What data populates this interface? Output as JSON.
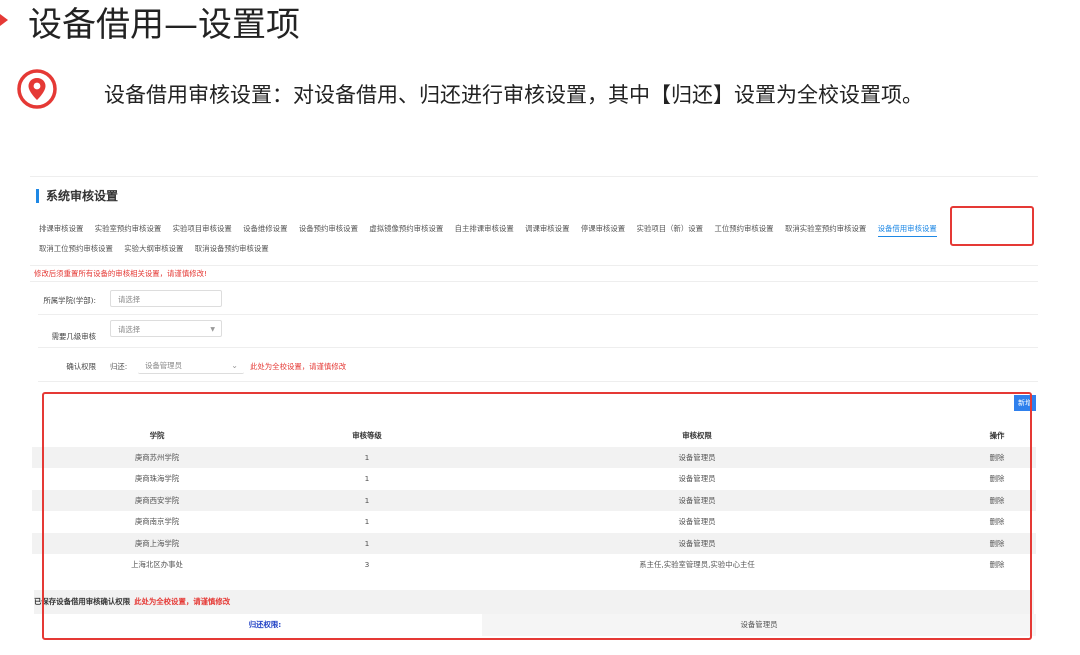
{
  "slide": {
    "title": "设备借用—设置项",
    "description": "设备借用审核设置：对设备借用、归还进行审核设置，其中【归还】设置为全校设置项。"
  },
  "panel": {
    "title": "系统审核设置",
    "tabs": [
      "排课审核设置",
      "实验室预约审核设置",
      "实验项目审核设置",
      "设备维修设置",
      "设备预约审核设置",
      "虚拟镜像预约审核设置",
      "自主排课审核设置",
      "调课审核设置",
      "停课审核设置",
      "实验项目（新）设置",
      "工位预约审核设置",
      "取消实验室预约审核设置",
      "设备借用审核设置",
      "取消工位预约审核设置",
      "实验大纲审核设置",
      "取消设备预约审核设置"
    ],
    "active_tab": "设备借用审核设置",
    "warning": "修改后须重置所有设备的审核相关设置，请谨慎修改!",
    "form": {
      "college_label": "所属学院(学部):",
      "college_placeholder": "请选择",
      "levels_label": "需要几级审核",
      "levels_placeholder": "请选择",
      "confirm_label": "确认权限",
      "return_prefix": "归还:",
      "return_value": "设备管理员",
      "return_note_a": "此处为全校设置，",
      "return_note_b": "请谨慎修改"
    },
    "new_button": "新增",
    "table": {
      "headers": [
        "学院",
        "审核等级",
        "审核权限",
        "操作"
      ],
      "rows": [
        [
          "庚商苏州学院",
          "1",
          "设备管理员",
          "删除"
        ],
        [
          "庚商珠海学院",
          "1",
          "设备管理员",
          "删除"
        ],
        [
          "庚商西安学院",
          "1",
          "设备管理员",
          "删除"
        ],
        [
          "庚商南京学院",
          "1",
          "设备管理员",
          "删除"
        ],
        [
          "庚商上海学院",
          "1",
          "设备管理员",
          "删除"
        ],
        [
          "上海北区办事处",
          "3",
          "系主任,实验室管理员,实验中心主任",
          "删除"
        ]
      ]
    },
    "saved_text": "已保存设备借用审核确认权限",
    "saved_note": "此处为全校设置，请谨慎修改",
    "return_row_label": "归还权限:",
    "return_row_value": "设备管理员"
  },
  "colors": {
    "accent_red": "#e53935",
    "accent_blue": "#1e88e5"
  }
}
